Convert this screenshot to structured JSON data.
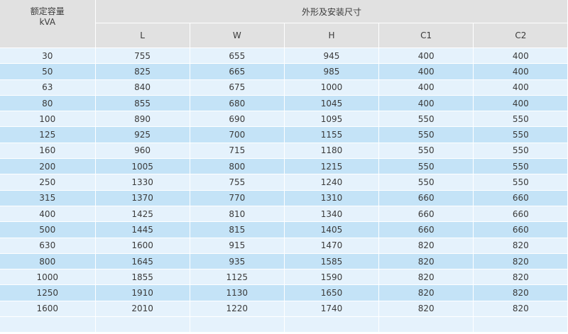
{
  "header": {
    "rated_line1": "额定容量",
    "rated_line2": "kVA",
    "group": "外形及安装尺寸",
    "columns": [
      "L",
      "W",
      "H",
      "C1",
      "C2"
    ]
  },
  "rows": [
    [
      "30",
      "755",
      "655",
      "945",
      "400",
      "400"
    ],
    [
      "50",
      "825",
      "665",
      "985",
      "400",
      "400"
    ],
    [
      "63",
      "840",
      "675",
      "1000",
      "400",
      "400"
    ],
    [
      "80",
      "855",
      "680",
      "1045",
      "400",
      "400"
    ],
    [
      "100",
      "890",
      "690",
      "1095",
      "550",
      "550"
    ],
    [
      "125",
      "925",
      "700",
      "1155",
      "550",
      "550"
    ],
    [
      "160",
      "960",
      "715",
      "1180",
      "550",
      "550"
    ],
    [
      "200",
      "1005",
      "800",
      "1215",
      "550",
      "550"
    ],
    [
      "250",
      "1330",
      "755",
      "1240",
      "550",
      "550"
    ],
    [
      "315",
      "1370",
      "770",
      "1310",
      "660",
      "660"
    ],
    [
      "400",
      "1425",
      "810",
      "1340",
      "660",
      "660"
    ],
    [
      "500",
      "1445",
      "815",
      "1405",
      "660",
      "660"
    ],
    [
      "630",
      "1600",
      "915",
      "1470",
      "820",
      "820"
    ],
    [
      "800",
      "1645",
      "935",
      "1585",
      "820",
      "820"
    ],
    [
      "1000",
      "1855",
      "1125",
      "1590",
      "820",
      "820"
    ],
    [
      "1250",
      "1910",
      "1130",
      "1650",
      "820",
      "820"
    ],
    [
      "1600",
      "2010",
      "1220",
      "1740",
      "820",
      "820"
    ]
  ],
  "colors": {
    "header_bg": "#e1e1e1",
    "row_light": "#e5f2fc",
    "row_dark": "#c4e3f7"
  }
}
